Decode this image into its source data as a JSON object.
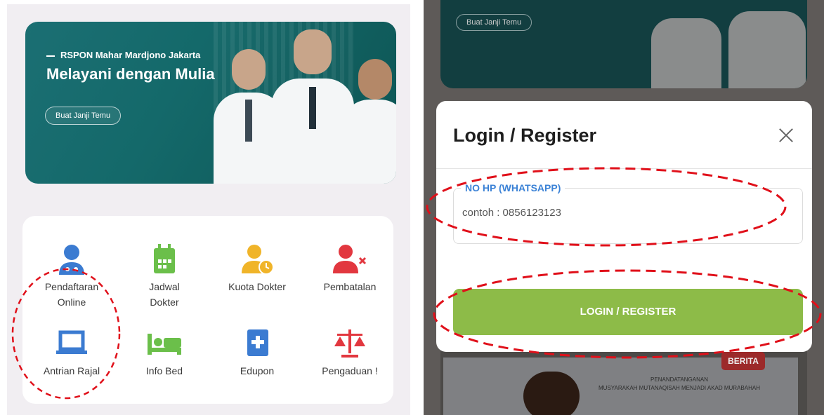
{
  "left": {
    "hero": {
      "subtitle": "RSPON Mahar Mardjono Jakarta",
      "title": "Melayani dengan Mulia",
      "button_label": "Buat Janji Temu"
    },
    "menu": [
      {
        "label_line1": "Pendaftaran",
        "label_line2": "Online",
        "icon": "doctor-person-icon",
        "color": "#3b7bd1"
      },
      {
        "label_line1": "Jadwal",
        "label_line2": "Dokter",
        "icon": "calendar-icon",
        "color": "#6bbf4a"
      },
      {
        "label_line1": "Kuota Dokter",
        "label_line2": "",
        "icon": "person-clock-icon",
        "color": "#f0b429"
      },
      {
        "label_line1": "Pembatalan",
        "label_line2": "",
        "icon": "person-cancel-icon",
        "color": "#e2373f"
      },
      {
        "label_line1": "Antrian Rajal",
        "label_line2": "",
        "icon": "laptop-icon",
        "color": "#3b7bd1"
      },
      {
        "label_line1": "Info Bed",
        "label_line2": "",
        "icon": "bed-icon",
        "color": "#6bbf4a"
      },
      {
        "label_line1": "Edupon",
        "label_line2": "",
        "icon": "medical-book-icon",
        "color": "#3b7bd1"
      },
      {
        "label_line1": "Pengaduan !",
        "label_line2": "",
        "icon": "scales-icon",
        "color": "#e2373f"
      }
    ]
  },
  "right": {
    "background_button": "Buat Janji Temu",
    "berita_label": "BERITA",
    "announcement_line1": "PENANDATANGANAN",
    "announcement_line2": "MUSYARAKAH MUTANAQISAH MENJADI AKAD MURABAHAH",
    "modal": {
      "title": "Login / Register",
      "field_label": "NO HP (WHATSAPP)",
      "field_placeholder": "contoh : 0856123123",
      "submit_label": "LOGIN / REGISTER"
    }
  },
  "colors": {
    "accent_green": "#8dbb48",
    "accent_blue": "#3b82d6",
    "annotation_red": "#e0101a",
    "hero_teal": "#14696a"
  }
}
